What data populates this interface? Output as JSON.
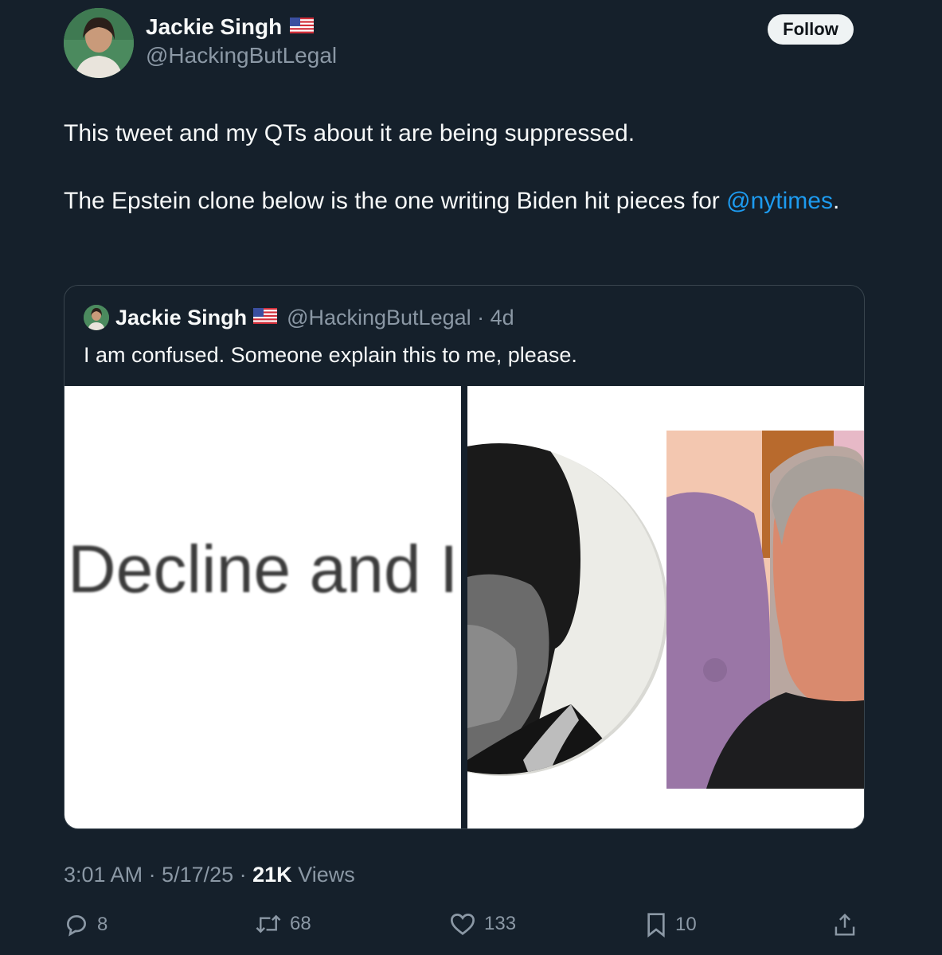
{
  "author": {
    "display_name": "Jackie Singh",
    "flag_icon": "us-flag-icon",
    "handle": "@HackingButLegal",
    "follow_label": "Follow"
  },
  "tweet": {
    "line1": "This tweet and my QTs about it are being suppressed.",
    "line2_prefix": "The Epstein clone below is the one writing Biden hit pieces for ",
    "line2_mention": "@nytimes",
    "line2_suffix": "."
  },
  "quoted": {
    "display_name": "Jackie Singh",
    "handle_time": "@HackingButLegal · 4d",
    "text": "I am confused. Someone explain this to me, please.",
    "image_left_text": "Decline and I"
  },
  "meta": {
    "time_date": "3:01 AM · 5/17/25 · ",
    "views_count": "21K",
    "views_label": " Views"
  },
  "actions": {
    "replies": "8",
    "reposts": "68",
    "likes": "133",
    "bookmarks": "10"
  },
  "colors": {
    "background": "#15202b",
    "text": "#f7f9f9",
    "secondary": "#8b98a5",
    "link": "#1d9bf0",
    "border": "#38444d"
  }
}
